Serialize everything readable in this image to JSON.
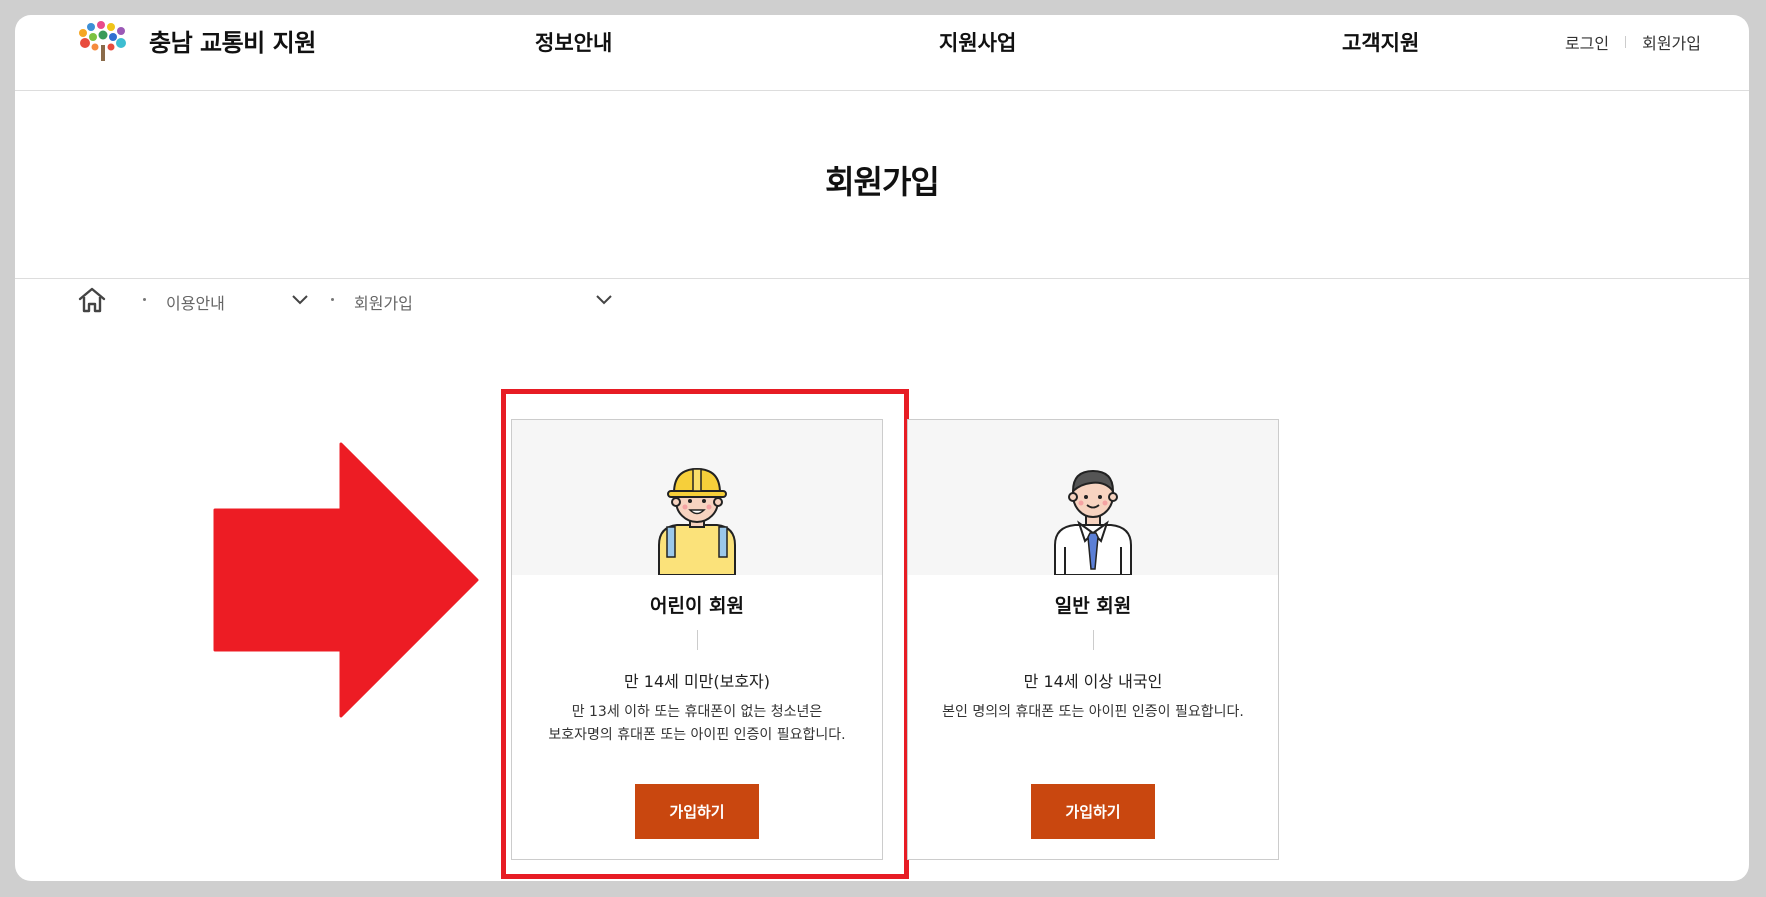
{
  "header": {
    "logo_text": "충남 교통비 지원",
    "nav": [
      "정보안내",
      "지원사업",
      "고객지원"
    ],
    "login_label": "로그인",
    "signup_label": "회원가입"
  },
  "page": {
    "title": "회원가입"
  },
  "breadcrumb": {
    "level1": "이용안내",
    "level2": "회원가입"
  },
  "cards": [
    {
      "title": "어린이 회원",
      "subtitle": "만 14세 미만(보호자)",
      "desc_line1": "만 13세 이하 또는 휴대폰이 없는 청소년은",
      "desc_line2": "보호자명의 휴대폰 또는 아이핀 인증이 필요합니다.",
      "button": "가입하기"
    },
    {
      "title": "일반 회원",
      "subtitle": "만 14세 이상 내국인",
      "desc_line1": "본인 명의의 휴대폰 또는 아이핀 인증이 필요합니다.",
      "button": "가입하기"
    }
  ],
  "colors": {
    "accent_button": "#c9470f",
    "highlight_red": "#e71c24"
  }
}
